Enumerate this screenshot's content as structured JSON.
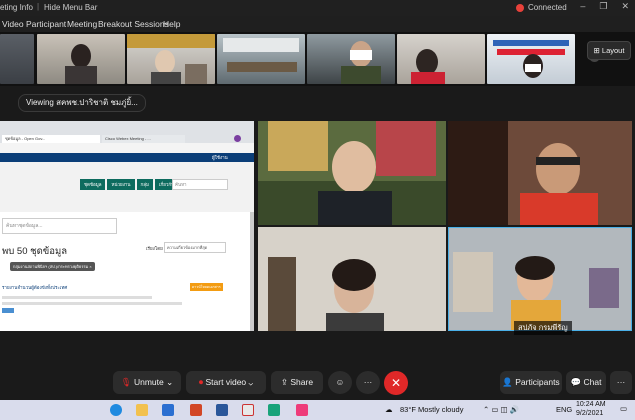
{
  "titlebar": {
    "app_title": "eting Info",
    "hide_menu": "Hide Menu Bar",
    "status": "Connected",
    "controls": [
      "–",
      "❐",
      "✕"
    ]
  },
  "menu": {
    "items": [
      "Video",
      "Participant",
      "Meeting",
      "Breakout Sessions",
      "Help"
    ]
  },
  "banner": {
    "viewing": "Viewing สคพช.ปาริชาติ ชมภู่ยิ้..."
  },
  "layout_button": "Layout",
  "next_arrow": "›",
  "shared_screen": {
    "tabs": [
      "ชุดข้อมูล - Open Gov...",
      "Cisco Webex Meeting - ..."
    ],
    "nav_buttons": [
      "ชุดข้อมูล",
      "หน่วยงาน",
      "กลุ่ม",
      "เกี่ยวกับ"
    ],
    "search_placeholder": "ค้นหา",
    "search2_placeholder": "ค้นหาชุดข้อมูล...",
    "heading": "พบ 50 ชุดข้อมูล",
    "sort_label": "เรียงโดย",
    "sort_value": "ความเกี่ยวข้องมากที่สุด",
    "filter_tag": "กลุ่มงานสถานพินิจฯ (สป.)/กระทรวงยุติธรรม ×",
    "item_title": "รายงานจำนวนผู้ต้องขังทั้งประเทศ",
    "item_badge": "ดาวน์โหลดเอกสาร",
    "user_label": "ผู้ใช้งาน"
  },
  "participant_name": "สปภัจ กรมพีรัญ",
  "toolbar": {
    "unmute": "Unmute",
    "start_video": "Start video",
    "share": "Share",
    "participants": "Participants",
    "chat": "Chat"
  },
  "taskbar": {
    "weather": "83°F Mostly cloudy",
    "lang": "ENG",
    "time": "10:24 AM",
    "date": "9/2/2021"
  },
  "colors": {
    "red": "#e02828",
    "toolbar_bg": "#2c2c2c",
    "gov_nav": "#0d6b5e"
  }
}
